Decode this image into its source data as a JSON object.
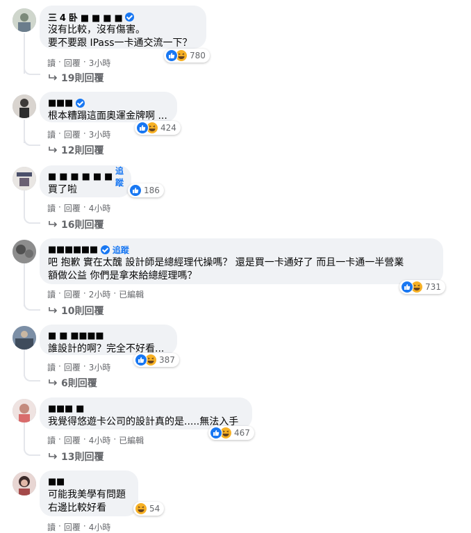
{
  "comments": [
    {
      "name": "三 4 卧 ■ ■ ■ ■",
      "badge": true,
      "follow": "",
      "text": "沒有比較，沒有傷害。\n要不要跟 IPass一卡通交流一下？",
      "reactions": [
        "like",
        "haha"
      ],
      "count": "780",
      "actions": {
        "read": "讀",
        "reply": "回覆",
        "time": "3小時",
        "edited": ""
      },
      "replies": "19則回覆"
    },
    {
      "name": "■■■",
      "badge": true,
      "follow": "",
      "text": "根本糟蹋這面奧運金牌啊 ...",
      "reactions": [
        "like",
        "haha"
      ],
      "count": "424",
      "actions": {
        "read": "讀",
        "reply": "回覆",
        "time": "3小時",
        "edited": ""
      },
      "replies": "12則回覆"
    },
    {
      "name": "■ ■ ■ ■ ■ ■",
      "badge": false,
      "follow": "追蹤",
      "text": "買了啦",
      "reactions": [
        "like"
      ],
      "count": "186",
      "actions": {
        "read": "讀",
        "reply": "回覆",
        "time": "4小時",
        "edited": ""
      },
      "replies": "16則回覆"
    },
    {
      "name": "■■■■■■",
      "badge": true,
      "follow": "追蹤",
      "text": "吧 抱歉 實在太醜 設計師是總經理代操嗎？ 還是買一卡通好了 而且一卡通一半營業\n額做公益 你們是拿來給總經理嗎？",
      "reactions": [
        "like",
        "haha"
      ],
      "count": "731",
      "actions": {
        "read": "讀",
        "reply": "回覆",
        "time": "2小時",
        "edited": "已編輯"
      },
      "replies": "10則回覆"
    },
    {
      "name": "■ ■ ■■■■",
      "badge": false,
      "follow": "",
      "text": "誰設計的啊？完全不好看...",
      "reactions": [
        "like",
        "haha"
      ],
      "count": "387",
      "actions": {
        "read": "讀",
        "reply": "回覆",
        "time": "3小時",
        "edited": ""
      },
      "replies": "6則回覆"
    },
    {
      "name": "■■■ ■",
      "badge": false,
      "follow": "",
      "text": "我覺得悠遊卡公司的設計真的是.....無法入手",
      "reactions": [
        "like",
        "haha"
      ],
      "count": "467",
      "actions": {
        "read": "讀",
        "reply": "回覆",
        "time": "4小時",
        "edited": "已編輯"
      },
      "replies": "13則回覆"
    },
    {
      "name": "■■",
      "badge": false,
      "follow": "",
      "text": "可能我美學有問題\n右邊比較好看",
      "reactions": [
        "haha"
      ],
      "count": "54",
      "actions": {
        "read": "讀",
        "reply": "回覆",
        "time": "4小時",
        "edited": ""
      },
      "replies": ""
    }
  ],
  "icons": {
    "like": "thumbs-up-icon",
    "haha": "laughing-face-icon",
    "reply": "reply-arrow-icon",
    "verified": "verified-badge-icon"
  },
  "colors": {
    "accent": "#1877f2",
    "bubble": "#f0f2f5",
    "muted": "#65676b",
    "haha": "#f7b125"
  }
}
